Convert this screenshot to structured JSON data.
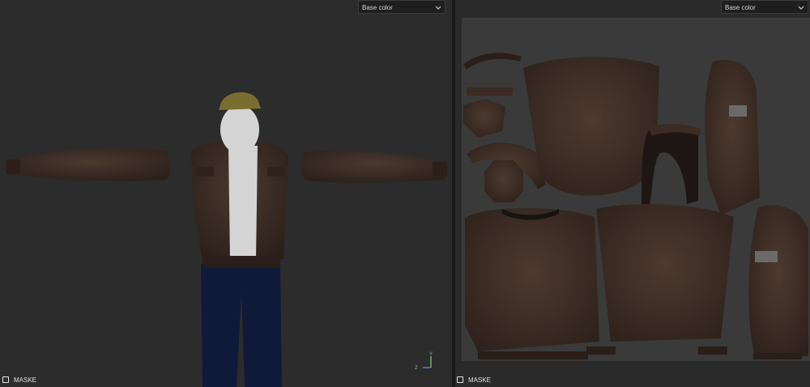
{
  "left_panel": {
    "view_mode": "Base color",
    "mask_label": "MASKE",
    "axis_labels": {
      "y": "Y",
      "z": "Z"
    }
  },
  "right_panel": {
    "view_mode": "Base color",
    "mask_label": "MASKE"
  },
  "icons": {
    "dropdown": "chevron-down-icon",
    "mask": "checkbox-icon",
    "axis": "axis-gizmo-icon"
  },
  "colors": {
    "leather": "#3d2d24",
    "leather_dark": "#2a1e18",
    "jeans": "#0f1a3a",
    "cap": "#7a6d30",
    "skin": "#d4d4d4",
    "uv_bg": "#3a3a3a"
  }
}
